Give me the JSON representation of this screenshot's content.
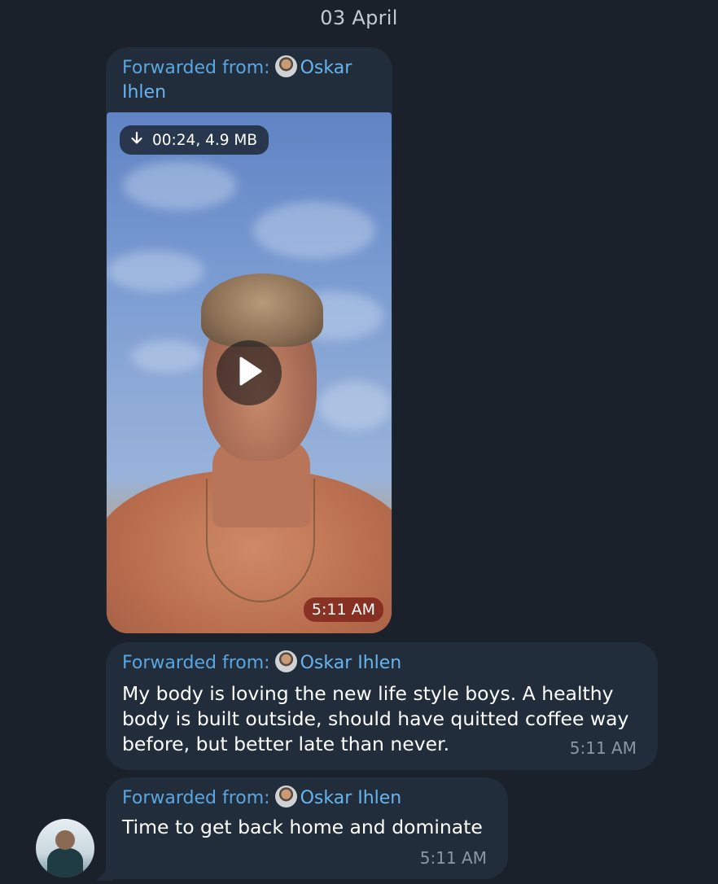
{
  "date_separator": "03 April",
  "messages": [
    {
      "forwarded_label": "Forwarded from:",
      "forwarded_name_line1": "Oskar",
      "forwarded_name_line2": "Ihlen",
      "media": {
        "type": "video",
        "info": "00:24, 4.9 MB",
        "time": "5:11 AM",
        "icon_download": "download-arrow-icon",
        "icon_play": "play-icon"
      }
    },
    {
      "forwarded_label": "Forwarded from:",
      "forwarded_name": "Oskar Ihlen",
      "text": "My body is loving the new life style boys. A healthy body is built outside, should have quitted coffee way before, but better late than never.",
      "time": "5:11 AM"
    },
    {
      "forwarded_label": "Forwarded from:",
      "forwarded_name": "Oskar Ihlen",
      "text": "Time to get back home and dominate",
      "time": "5:11 AM"
    }
  ],
  "colors": {
    "background": "#1a212a",
    "bubble": "#212d3b",
    "link": "#5ba6e0",
    "time": "#8b96a3"
  }
}
